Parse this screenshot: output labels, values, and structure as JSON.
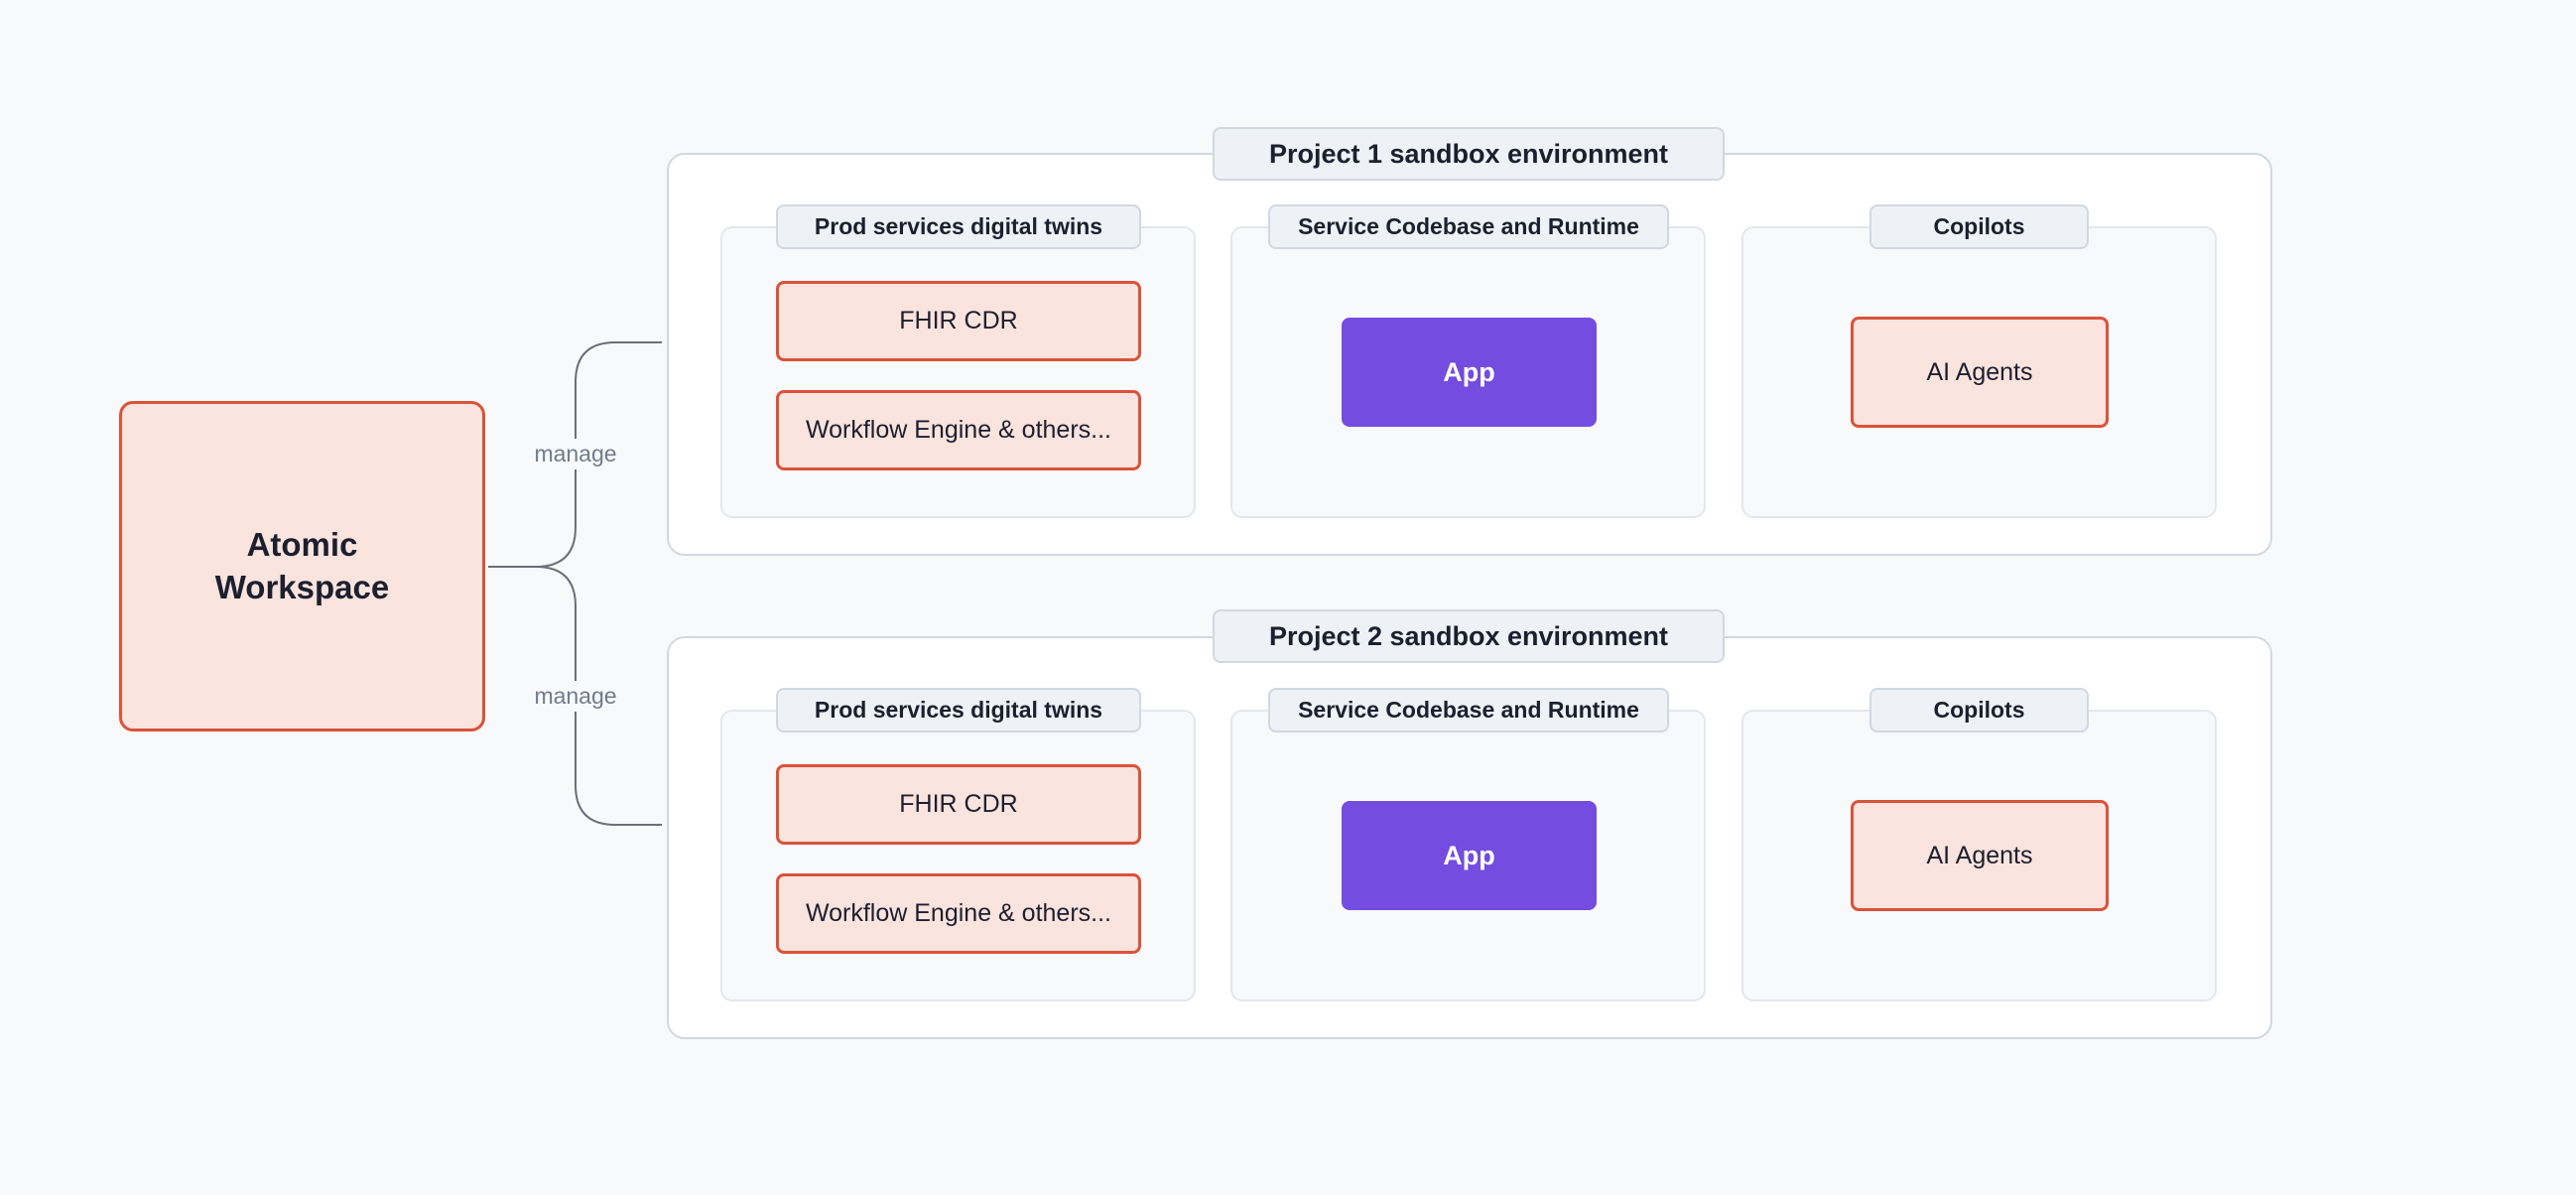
{
  "workspace": {
    "title": "Atomic Workspace"
  },
  "edges": [
    {
      "label": "manage"
    },
    {
      "label": "manage"
    }
  ],
  "projects": [
    {
      "title": "Project 1 sandbox environment",
      "groups": [
        {
          "title": "Prod services digital twins",
          "items": [
            "FHIR CDR",
            "Workflow Engine & others..."
          ]
        },
        {
          "title": "Service Codebase and Runtime",
          "items": [
            "App"
          ]
        },
        {
          "title": "Copilots",
          "items": [
            "AI Agents"
          ]
        }
      ]
    },
    {
      "title": "Project 2 sandbox environment",
      "groups": [
        {
          "title": "Prod services digital twins",
          "items": [
            "FHIR CDR",
            "Workflow Engine & others..."
          ]
        },
        {
          "title": "Service Codebase and Runtime",
          "items": [
            "App"
          ]
        },
        {
          "title": "Copilots",
          "items": [
            "AI Agents"
          ]
        }
      ]
    }
  ],
  "colors": {
    "background": "#f8f9fb",
    "node_fill": "#fbe3de",
    "node_border": "#d9533a",
    "app_fill": "#744ce0",
    "edge": "#6b6f78",
    "edge_label": "#707b8c"
  }
}
